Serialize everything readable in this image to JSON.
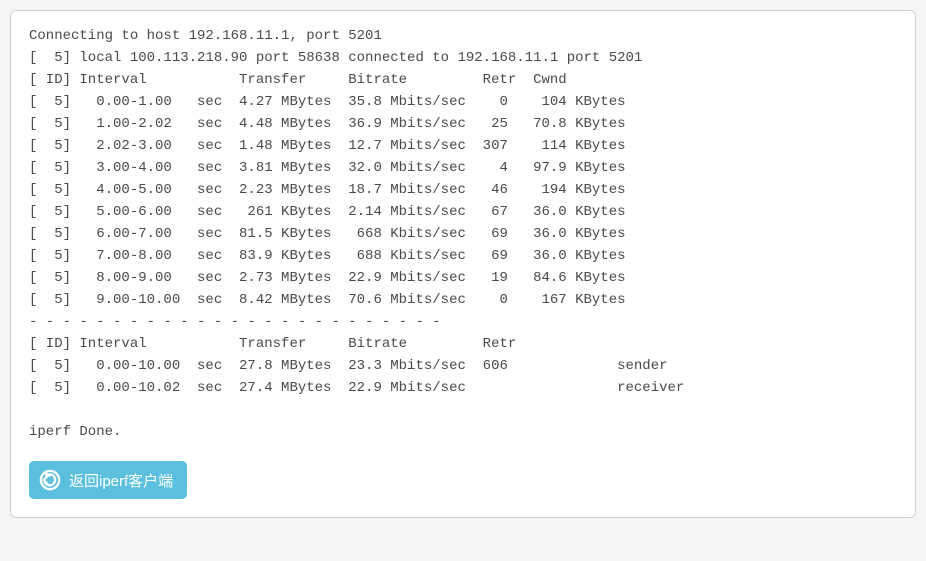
{
  "terminal": {
    "connecting_line": "Connecting to host 192.168.11.1, port 5201",
    "local_line": "[  5] local 100.113.218.90 port 58638 connected to 192.168.11.1 port 5201",
    "header_line": "[ ID] Interval           Transfer     Bitrate         Retr  Cwnd",
    "rows": [
      "[  5]   0.00-1.00   sec  4.27 MBytes  35.8 Mbits/sec    0    104 KBytes",
      "[  5]   1.00-2.02   sec  4.48 MBytes  36.9 Mbits/sec   25   70.8 KBytes",
      "[  5]   2.02-3.00   sec  1.48 MBytes  12.7 Mbits/sec  307    114 KBytes",
      "[  5]   3.00-4.00   sec  3.81 MBytes  32.0 Mbits/sec    4   97.9 KBytes",
      "[  5]   4.00-5.00   sec  2.23 MBytes  18.7 Mbits/sec   46    194 KBytes",
      "[  5]   5.00-6.00   sec   261 KBytes  2.14 Mbits/sec   67   36.0 KBytes",
      "[  5]   6.00-7.00   sec  81.5 KBytes   668 Kbits/sec   69   36.0 KBytes",
      "[  5]   7.00-8.00   sec  83.9 KBytes   688 Kbits/sec   69   36.0 KBytes",
      "[  5]   8.00-9.00   sec  2.73 MBytes  22.9 Mbits/sec   19   84.6 KBytes",
      "[  5]   9.00-10.00  sec  8.42 MBytes  70.6 Mbits/sec    0    167 KBytes"
    ],
    "separator_line": "- - - - - - - - - - - - - - - - - - - - - - - - -",
    "summary_header": "[ ID] Interval           Transfer     Bitrate         Retr",
    "summary_rows": [
      "[  5]   0.00-10.00  sec  27.8 MBytes  23.3 Mbits/sec  606             sender",
      "[  5]   0.00-10.02  sec  27.4 MBytes  22.9 Mbits/sec                  receiver"
    ],
    "done_line": "iperf Done."
  },
  "button": {
    "label": "返回iperf客户端"
  }
}
